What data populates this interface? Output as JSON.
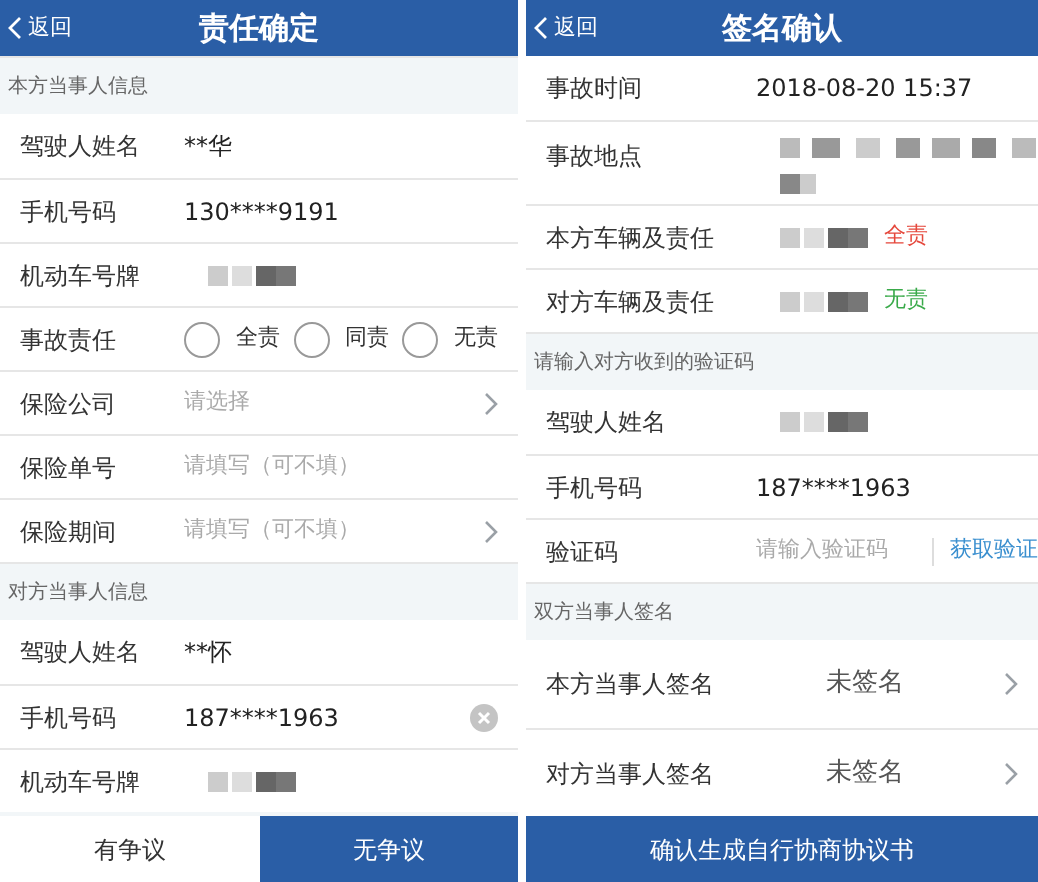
{
  "left": {
    "back": "返回",
    "title": "责任确定",
    "sections": [
      {
        "header": "本方当事人信息",
        "rows": [
          {
            "kind": "text",
            "label": "驾驶人姓名",
            "value": "**华"
          },
          {
            "kind": "text",
            "label": "手机号码",
            "value": "130****9191"
          },
          {
            "kind": "redacted",
            "label": "机动车号牌"
          },
          {
            "kind": "radio",
            "label": "事故责任",
            "options": [
              {
                "label": "全责",
                "selected": false
              },
              {
                "label": "同责",
                "selected": false
              },
              {
                "label": "无责",
                "selected": false
              }
            ]
          },
          {
            "kind": "select",
            "label": "保险公司",
            "placeholder": "请选择"
          },
          {
            "kind": "input",
            "label": "保险单号",
            "placeholder": "请填写（可不填）"
          },
          {
            "kind": "select",
            "label": "保险期间",
            "placeholder": "请填写（可不填）"
          }
        ]
      },
      {
        "header": "对方当事人信息",
        "rows": [
          {
            "kind": "text",
            "label": "驾驶人姓名",
            "value": "**怀"
          },
          {
            "kind": "clearable",
            "label": "手机号码",
            "value": "187****1963"
          },
          {
            "kind": "redacted",
            "label": "机动车号牌"
          }
        ]
      }
    ],
    "buttons": [
      {
        "label": "有争议",
        "selected": false
      },
      {
        "label": "无争议",
        "selected": true
      }
    ]
  },
  "right": {
    "back": "返回",
    "title": "签名确认",
    "sections": [
      {
        "rows": [
          {
            "kind": "text",
            "label": "事故时间",
            "value": "2018-08-20 15:37"
          },
          {
            "kind": "redacted",
            "label": "事故地点",
            "tall": true
          },
          {
            "kind": "redacted",
            "label": "本方车辆及责任",
            "suffix": "全责",
            "color": "#e5483c"
          },
          {
            "kind": "redacted",
            "label": "对方车辆及责任",
            "suffix": "无责",
            "color": "#3aaa4a"
          }
        ]
      },
      {
        "header": "请输入对方收到的验证码",
        "rows": [
          {
            "kind": "redacted",
            "label": "驾驶人姓名"
          },
          {
            "kind": "text",
            "label": "手机号码",
            "value": "187****1963"
          },
          {
            "kind": "code",
            "label": "验证码",
            "placeholder": "请输入验证码",
            "action": "获取验证"
          }
        ]
      },
      {
        "header": "双方当事人签名",
        "rows": [
          {
            "kind": "sign",
            "label": "本方当事人签名",
            "value": "未签名"
          },
          {
            "kind": "sign",
            "label": "对方当事人签名",
            "value": "未签名"
          }
        ]
      }
    ],
    "submit": "确认生成自行协商协议书"
  }
}
